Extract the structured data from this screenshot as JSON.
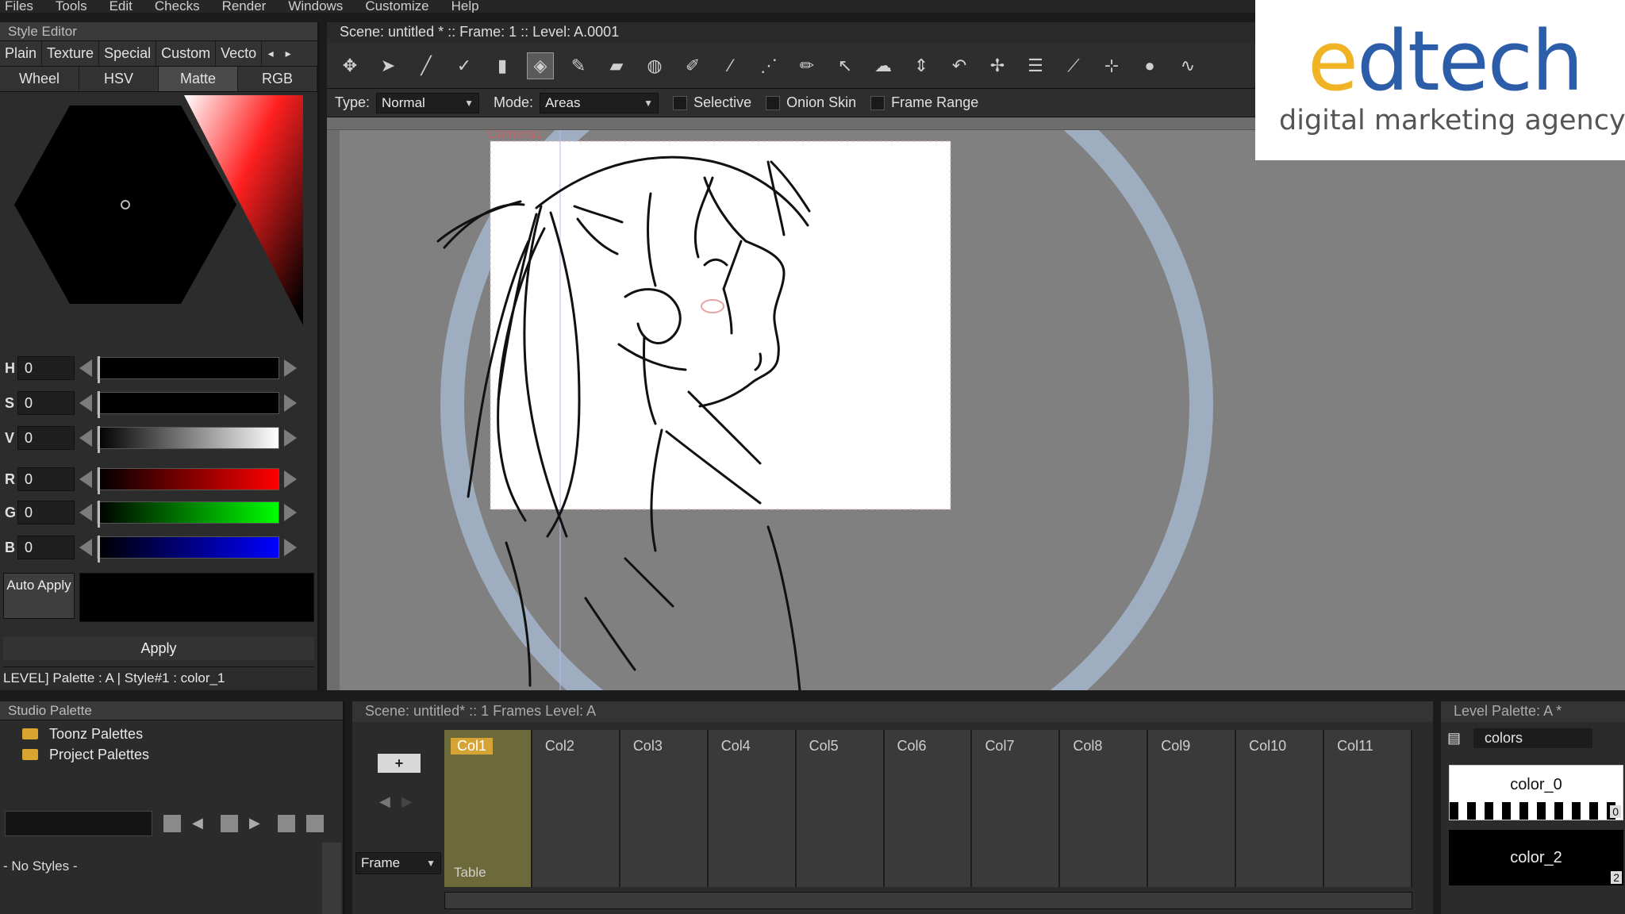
{
  "menu": [
    "Files",
    "Tools",
    "Edit",
    "Checks",
    "Render",
    "Windows",
    "Customize",
    "Help"
  ],
  "style_editor": {
    "title": "Style Editor",
    "category_tabs": [
      "Plain",
      "Texture",
      "Special",
      "Custom",
      "Vecto"
    ],
    "mode_tabs": [
      "Wheel",
      "HSV",
      "Matte",
      "RGB"
    ],
    "active_mode": "Matte",
    "sliders": [
      {
        "label": "H",
        "value": "0",
        "color": "#000000"
      },
      {
        "label": "S",
        "value": "0",
        "color": "#000000"
      },
      {
        "label": "V",
        "value": "0",
        "color": "#ffffff"
      },
      {
        "label": "R",
        "value": "0",
        "color": "#ff0000"
      },
      {
        "label": "G",
        "value": "0",
        "color": "#00ff00"
      },
      {
        "label": "B",
        "value": "0",
        "color": "#0000ff"
      }
    ],
    "auto_apply": "Auto Apply",
    "apply": "Apply",
    "status": "LEVEL]   Palette : A | Style#1 : color_1"
  },
  "viewer": {
    "title": "Scene: untitled *  ::  Frame: 1  ::  Level: A.0001",
    "type_label": "Type:",
    "type_value": "Normal",
    "mode_label": "Mode:",
    "mode_value": "Areas",
    "selective": "Selective",
    "onion_skin": "Onion Skin",
    "frame_range": "Frame Range",
    "camera_label": "Camera1"
  },
  "logo": {
    "letter_e": "e",
    "rest": "dtech",
    "tagline": "digital marketing agency"
  },
  "studio_palette": {
    "title": "Studio Palette",
    "items": [
      "Toonz Palettes",
      "Project Palettes"
    ],
    "no_styles": "- No Styles -"
  },
  "xsheet": {
    "title": "Scene: untitled*  ::  1 Frames  Level: A",
    "columns": [
      "Col1",
      "Col2",
      "Col3",
      "Col4",
      "Col5",
      "Col6",
      "Col7",
      "Col8",
      "Col9",
      "Col10",
      "Col11"
    ],
    "frame_label": "Frame",
    "table_label": "Table"
  },
  "level_palette": {
    "title": "Level Palette: A *",
    "name": "colors",
    "chips": [
      {
        "name": "color_0",
        "index": "0"
      },
      {
        "name": "color_2",
        "index": "2"
      }
    ]
  }
}
